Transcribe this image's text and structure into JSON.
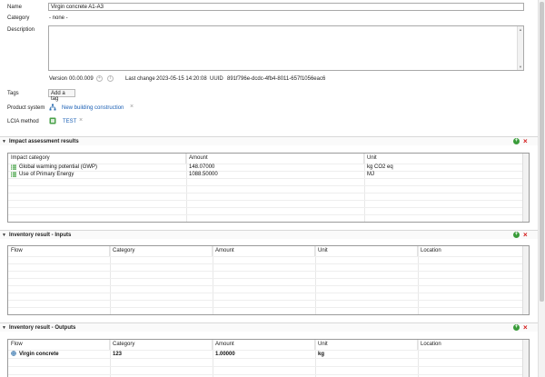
{
  "form": {
    "name_label": "Name",
    "name_value": "Virgin concrete A1-A3",
    "category_label": "Category",
    "category_value": "- none -",
    "description_label": "Description",
    "description_value": "",
    "version_label": "Version",
    "version_value": "00.00.009",
    "last_change_label": "Last change",
    "last_change_value": "2023-05-15 14:20:08",
    "uuid_label": "UUID",
    "uuid_value": "891f796e-dcdc-4fb4-8011-657f1056eac6",
    "tags_label": "Tags",
    "add_tag_label": "Add a tag",
    "product_system_label": "Product system",
    "product_system_value": "New building construction",
    "lcia_method_label": "LCIA method",
    "lcia_method_value": "TEST"
  },
  "impact": {
    "title": "Impact assessment results",
    "columns": [
      "Impact category",
      "Amount",
      "Unit"
    ],
    "rows": [
      {
        "category": "Global warming potential (GWP)",
        "amount": "148.07000",
        "unit": "kg CO2 eq"
      },
      {
        "category": "Use of Primary Energy",
        "amount": "1088.50000",
        "unit": "MJ"
      }
    ]
  },
  "inputs": {
    "title": "Inventory result - Inputs",
    "columns": [
      "Flow",
      "Category",
      "Amount",
      "Unit",
      "Location"
    ]
  },
  "outputs": {
    "title": "Inventory result - Outputs",
    "columns": [
      "Flow",
      "Category",
      "Amount",
      "Unit",
      "Location"
    ],
    "rows": [
      {
        "flow": "Virgin concrete",
        "category": "123",
        "amount": "1.00000",
        "unit": "kg",
        "location": ""
      }
    ]
  },
  "icons": {
    "collapse": "triangle-down-icon",
    "add": "plus-circle-icon",
    "remove": "red-x-icon"
  },
  "colors": {
    "link": "#1a5fb4",
    "add": "#3a9c3a",
    "remove": "#d41a1a"
  }
}
